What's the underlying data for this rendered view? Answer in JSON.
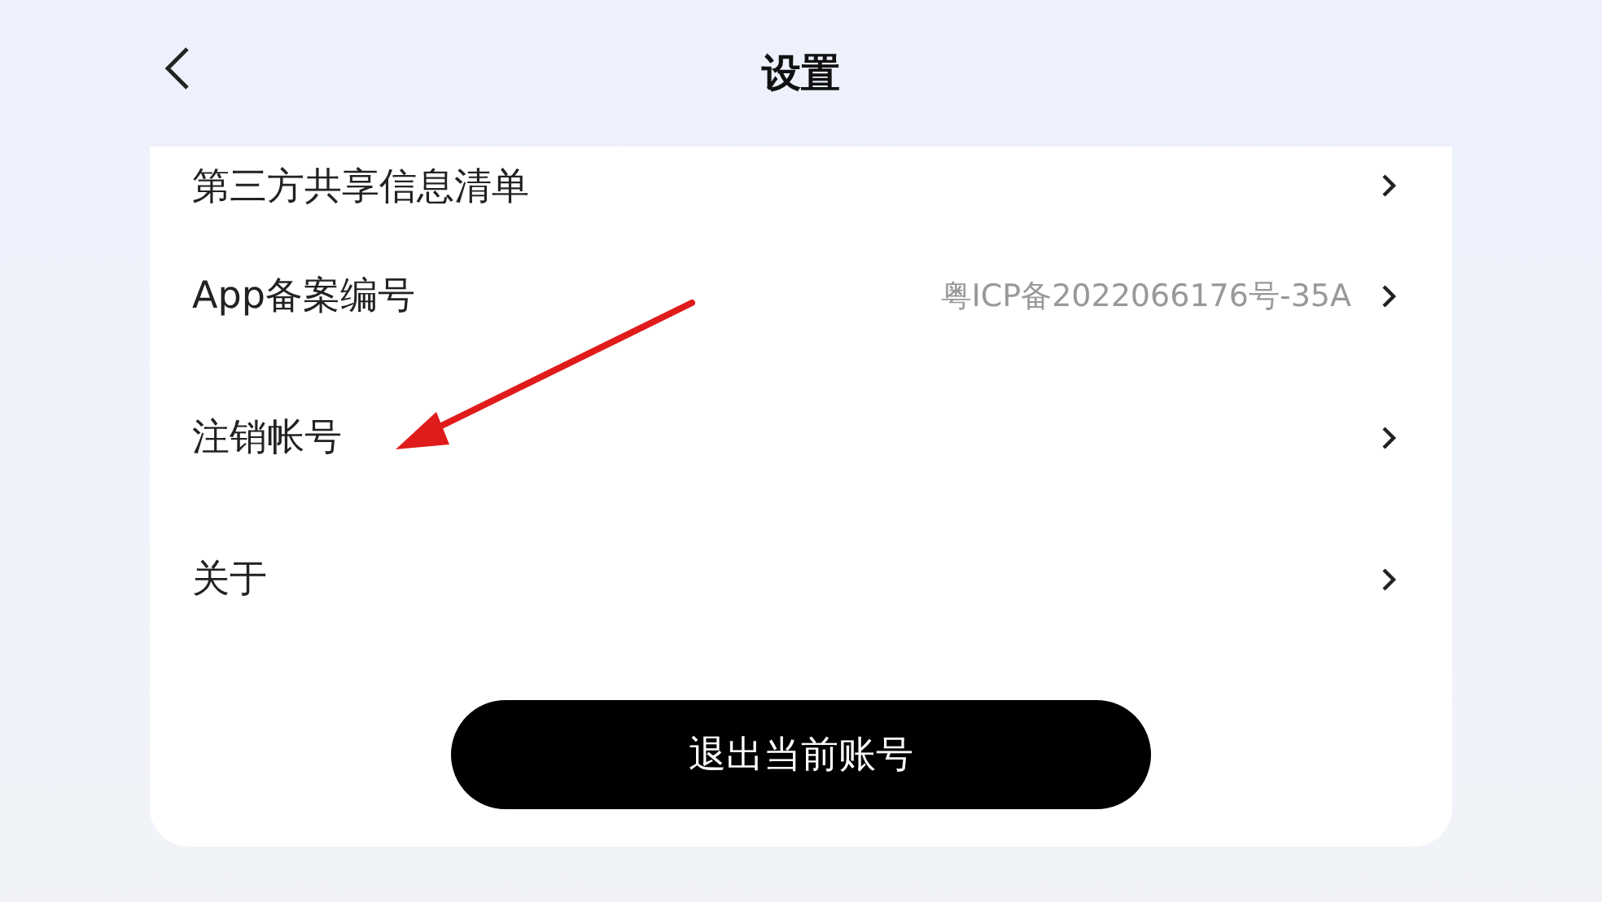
{
  "header": {
    "title": "设置"
  },
  "rows": [
    {
      "label": "第三方共享信息清单"
    },
    {
      "label": "App备案编号",
      "value": "粤ICP备2022066176号-35A"
    },
    {
      "label": "注销帐号"
    },
    {
      "label": "关于"
    }
  ],
  "logout_button": {
    "label": "退出当前账号"
  }
}
